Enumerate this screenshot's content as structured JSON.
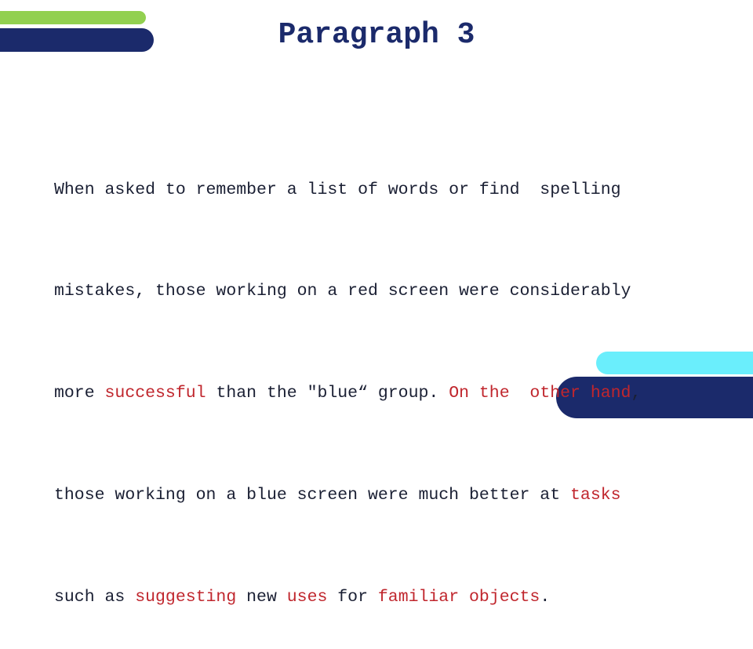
{
  "slide": {
    "title": "Paragraph 3",
    "colors": {
      "title": "#1b2a6b",
      "body": "#1a1f33",
      "highlight": "#c0262d",
      "accent_green": "#92d050",
      "accent_navy": "#1b2a6b",
      "accent_cyan": "#6aeefc"
    },
    "lines": [
      [
        {
          "text": "When asked to remember a list of words or find  spelling",
          "hl": false
        }
      ],
      [
        {
          "text": "mistakes, those working on a red screen were considerably",
          "hl": false
        }
      ],
      [
        {
          "text": "more ",
          "hl": false
        },
        {
          "text": "successful",
          "hl": true
        },
        {
          "text": " than the \"blue“ group. ",
          "hl": false
        },
        {
          "text": "On the  other hand",
          "hl": true
        },
        {
          "text": ",",
          "hl": false
        }
      ],
      [
        {
          "text": "those working on a blue screen were much better at ",
          "hl": false
        },
        {
          "text": "tasks",
          "hl": true
        }
      ],
      [
        {
          "text": "such as ",
          "hl": false
        },
        {
          "text": "suggesting",
          "hl": true
        },
        {
          "text": " new ",
          "hl": false
        },
        {
          "text": "uses",
          "hl": true
        },
        {
          "text": " for ",
          "hl": false
        },
        {
          "text": "familiar objects",
          "hl": true
        },
        {
          "text": ".",
          "hl": false
        }
      ]
    ]
  }
}
